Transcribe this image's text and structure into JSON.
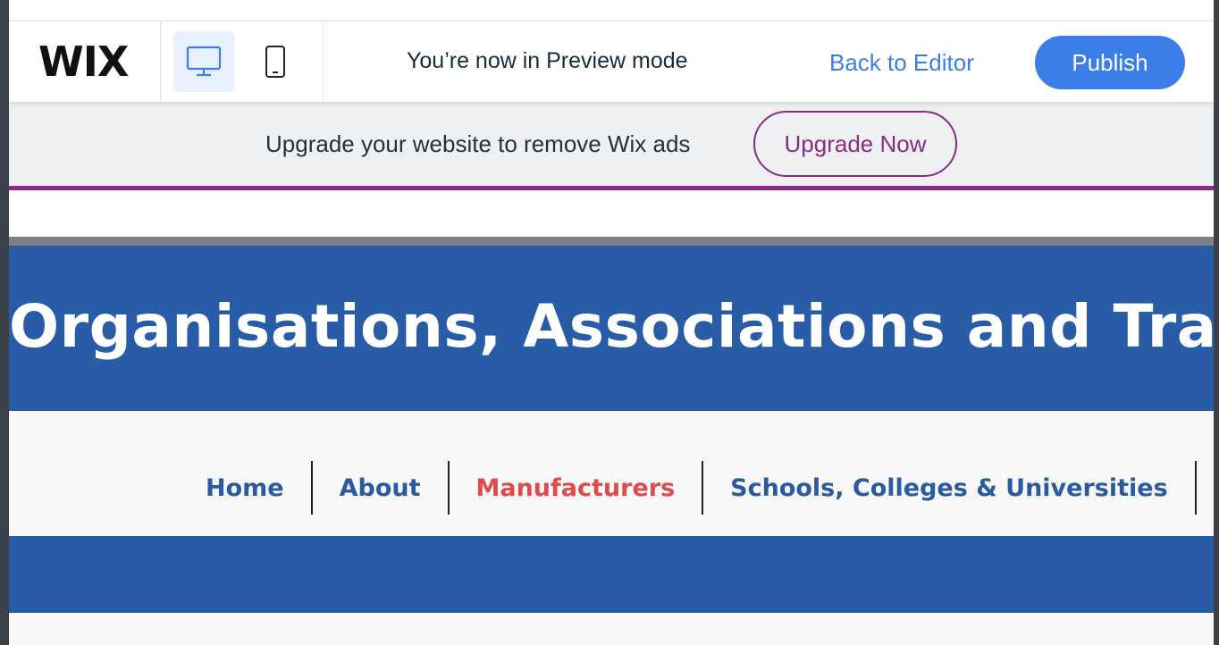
{
  "toolbar": {
    "logo": "WIX",
    "preview_text": "You’re now in Preview mode",
    "back_label": "Back to Editor",
    "publish_label": "Publish",
    "devices": [
      {
        "name": "desktop-icon",
        "active": true
      },
      {
        "name": "mobile-icon",
        "active": false
      }
    ]
  },
  "adbar": {
    "text": "Upgrade your website to remove Wix ads",
    "button": "Upgrade Now"
  },
  "site": {
    "hero_title": "Organisations, Associations and Trainin",
    "nav": [
      {
        "label": "Home",
        "active": false
      },
      {
        "label": "About",
        "active": false
      },
      {
        "label": "Manufacturers",
        "active": true
      },
      {
        "label": "Schools, Colleges & Universities",
        "active": false
      }
    ]
  },
  "colors": {
    "accent": "#3b7ee8",
    "upgrade": "#8b2b87",
    "site_blue": "#295ca7",
    "nav_active": "#e04a4a"
  }
}
